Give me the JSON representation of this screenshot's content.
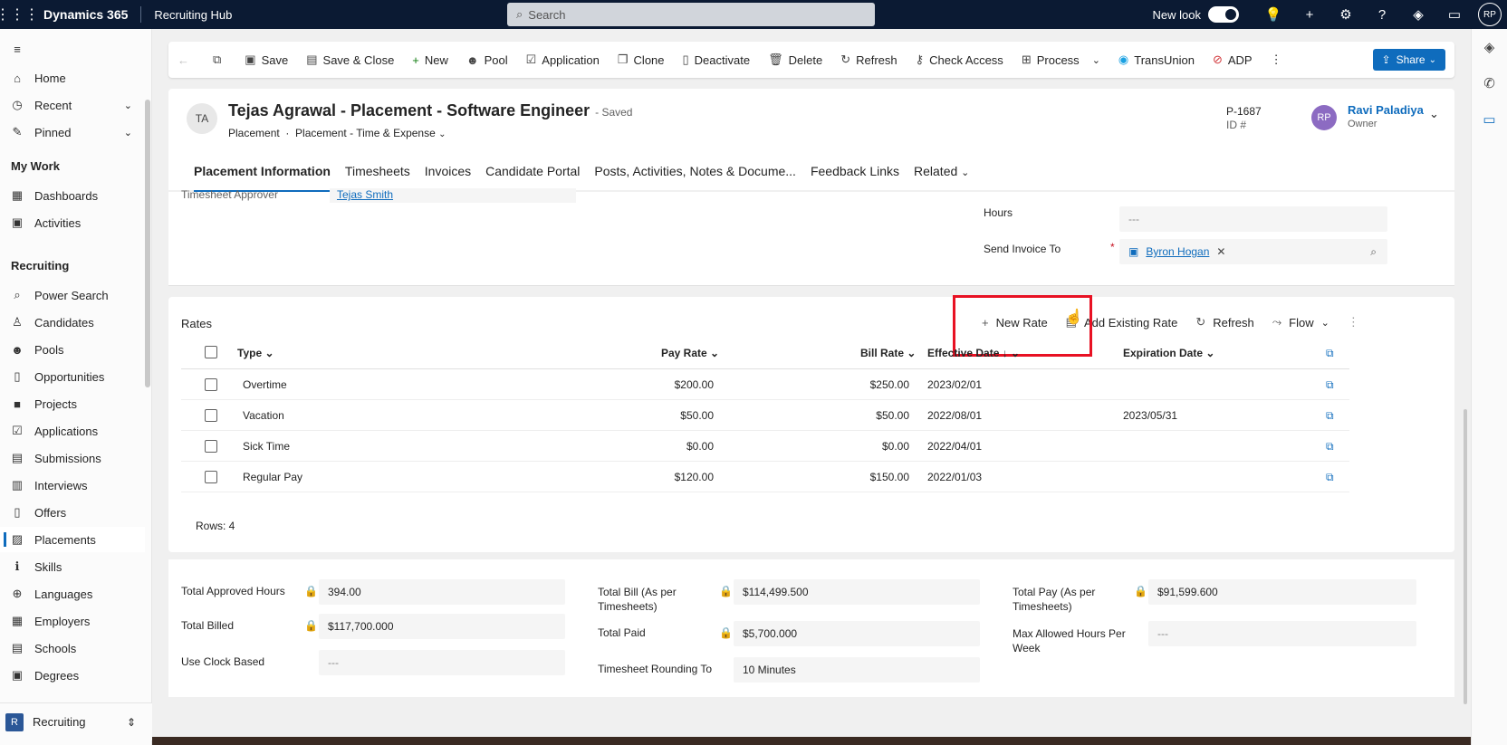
{
  "topbar": {
    "brand": "Dynamics 365",
    "app_name": "Recruiting Hub",
    "search_placeholder": "Search",
    "new_look_label": "New look",
    "user_initials": "RP"
  },
  "sidebar": {
    "home": "Home",
    "recent": "Recent",
    "pinned": "Pinned",
    "my_work_header": "My Work",
    "my_work": [
      "Dashboards",
      "Activities"
    ],
    "recruiting_header": "Recruiting",
    "recruiting": [
      "Power Search",
      "Candidates",
      "Pools",
      "Opportunities",
      "Projects",
      "Applications",
      "Submissions",
      "Interviews",
      "Offers",
      "Placements",
      "Skills",
      "Languages",
      "Employers",
      "Schools",
      "Degrees"
    ],
    "active_item": "Placements",
    "area_letter": "R",
    "area_name": "Recruiting"
  },
  "commandbar": {
    "save": "Save",
    "save_close": "Save & Close",
    "new": "New",
    "pool": "Pool",
    "application": "Application",
    "clone": "Clone",
    "deactivate": "Deactivate",
    "delete": "Delete",
    "refresh": "Refresh",
    "check_access": "Check Access",
    "process": "Process",
    "transunion": "TransUnion",
    "adp": "ADP",
    "share": "Share"
  },
  "record": {
    "initials": "TA",
    "title": "Tejas Agrawal - Placement - Software Engineer",
    "save_status": "- Saved",
    "entity": "Placement",
    "form": "Placement - Time & Expense",
    "id_value": "P-1687",
    "id_label": "ID #",
    "owner_initials": "RP",
    "owner_name": "Ravi Paladiya",
    "owner_label": "Owner"
  },
  "tabs": [
    "Placement Information",
    "Timesheets",
    "Invoices",
    "Candidate Portal",
    "Posts, Activities, Notes & Docume...",
    "Feedback Links",
    "Related"
  ],
  "section1": {
    "approver_label": "Timesheet Approver",
    "approver_value": "Tejas Smith",
    "hours_label": "Hours",
    "hours_value": "---",
    "send_invoice_label": "Send Invoice To",
    "send_invoice_value": "Byron Hogan"
  },
  "rates": {
    "title": "Rates",
    "toolbar": {
      "new_rate": "New Rate",
      "add_existing": "Add Existing Rate",
      "refresh": "Refresh",
      "flow": "Flow"
    },
    "columns": {
      "type": "Type",
      "pay_rate": "Pay Rate",
      "bill_rate": "Bill Rate",
      "effective_date": "Effective Date",
      "expiration_date": "Expiration Date"
    },
    "rows": [
      {
        "type": "Overtime",
        "pay_rate": "$200.00",
        "bill_rate": "$250.00",
        "effective_date": "2023/02/01",
        "expiration_date": ""
      },
      {
        "type": "Vacation",
        "pay_rate": "$50.00",
        "bill_rate": "$50.00",
        "effective_date": "2022/08/01",
        "expiration_date": "2023/05/31"
      },
      {
        "type": "Sick Time",
        "pay_rate": "$0.00",
        "bill_rate": "$0.00",
        "effective_date": "2022/04/01",
        "expiration_date": ""
      },
      {
        "type": "Regular Pay",
        "pay_rate": "$120.00",
        "bill_rate": "$150.00",
        "effective_date": "2022/01/03",
        "expiration_date": ""
      }
    ],
    "rows_count": "Rows: 4"
  },
  "totals": {
    "approved_hours_label": "Total Approved Hours",
    "approved_hours_value": "394.00",
    "billed_label": "Total Billed",
    "billed_value": "$117,700.000",
    "clock_label": "Use Clock Based",
    "clock_value": "---",
    "bill_ts_label": "Total Bill (As per Timesheets)",
    "bill_ts_value": "$114,499.500",
    "paid_label": "Total Paid",
    "paid_value": "$5,700.000",
    "rounding_label": "Timesheet Rounding To",
    "rounding_value": "10 Minutes",
    "pay_ts_label": "Total Pay (As per Timesheets)",
    "pay_ts_value": "$91,599.600",
    "max_hours_label": "Max Allowed Hours Per Week",
    "max_hours_value": "---"
  }
}
